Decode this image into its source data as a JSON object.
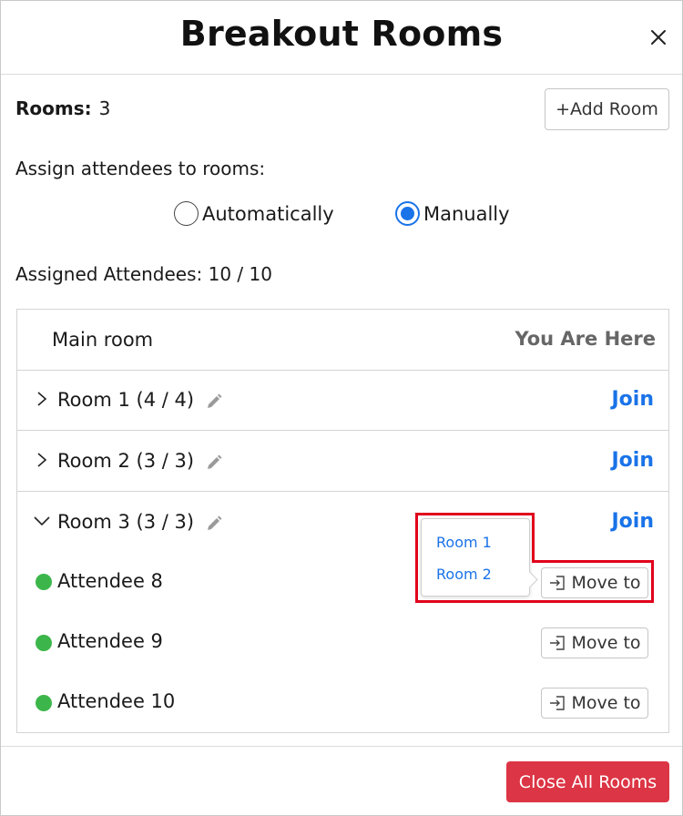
{
  "dialog": {
    "title": "Breakout Rooms",
    "close_icon": "close-icon"
  },
  "rooms": {
    "label": "Rooms:",
    "count": "3",
    "add_room_label": "+Add Room"
  },
  "assign": {
    "label": "Assign attendees to rooms:",
    "options": [
      {
        "label": "Automatically",
        "checked": false
      },
      {
        "label": "Manually",
        "checked": true
      }
    ]
  },
  "assigned": {
    "text": "Assigned Attendees: 10 / 10"
  },
  "main_room": {
    "label": "Main room",
    "status": "You Are Here"
  },
  "room_list": [
    {
      "name": "Room 1 (4 / 4)",
      "join": "Join",
      "expanded": false
    },
    {
      "name": "Room 2 (3 / 3)",
      "join": "Join",
      "expanded": false
    },
    {
      "name": "Room 3 (3 / 3)",
      "join": "Join",
      "expanded": true,
      "attendees": [
        {
          "name": "Attendee 8",
          "action": "Move to"
        },
        {
          "name": "Attendee 9",
          "action": "Move to"
        },
        {
          "name": "Attendee 10",
          "action": "Move to"
        }
      ]
    }
  ],
  "move_menu": {
    "items": [
      "Room 1",
      "Room 2"
    ]
  },
  "footer": {
    "close_all_label": "Close All Rooms"
  },
  "colors": {
    "accent": "#1a73e8",
    "danger": "#dc3545",
    "online": "#3cb64a",
    "highlight": "#e0001b"
  }
}
